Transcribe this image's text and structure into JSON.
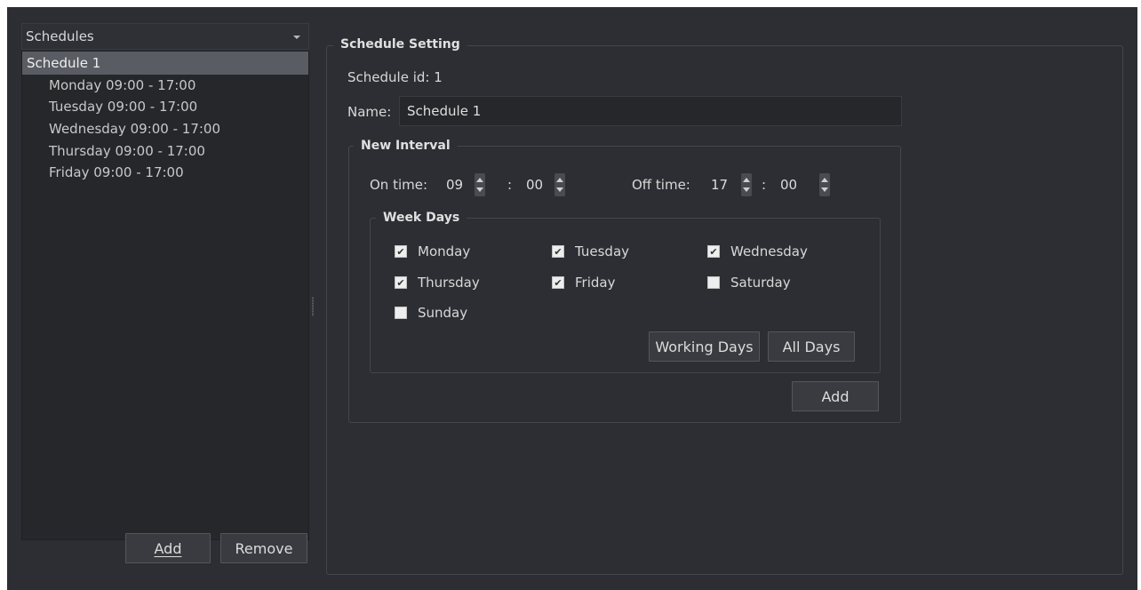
{
  "left": {
    "combo_value": "Schedules",
    "tree_root": "Schedule 1",
    "tree_items": [
      "Monday 09:00 - 17:00",
      "Tuesday 09:00 - 17:00",
      "Wednesday 09:00 - 17:00",
      "Thursday 09:00 - 17:00",
      "Friday 09:00 - 17:00"
    ],
    "add_label": "Add",
    "remove_label": "Remove"
  },
  "setting": {
    "title": "Schedule Setting",
    "schedule_id": "Schedule id: 1",
    "name_label": "Name:",
    "name_value": "Schedule 1"
  },
  "interval": {
    "title": "New Interval",
    "on_label": "On time:",
    "on_hour": "09",
    "on_min": "00",
    "off_label": "Off time:",
    "off_hour": "17",
    "off_min": "00",
    "colon": ":",
    "add_label": "Add"
  },
  "weekdays": {
    "title": "Week Days",
    "days": [
      {
        "label": "Monday",
        "checked": true
      },
      {
        "label": "Tuesday",
        "checked": true
      },
      {
        "label": "Wednesday",
        "checked": true
      },
      {
        "label": "Thursday",
        "checked": true
      },
      {
        "label": "Friday",
        "checked": true
      },
      {
        "label": "Saturday",
        "checked": false
      },
      {
        "label": "Sunday",
        "checked": false
      }
    ],
    "working_days_label": "Working Days",
    "all_days_label": "All Days"
  }
}
